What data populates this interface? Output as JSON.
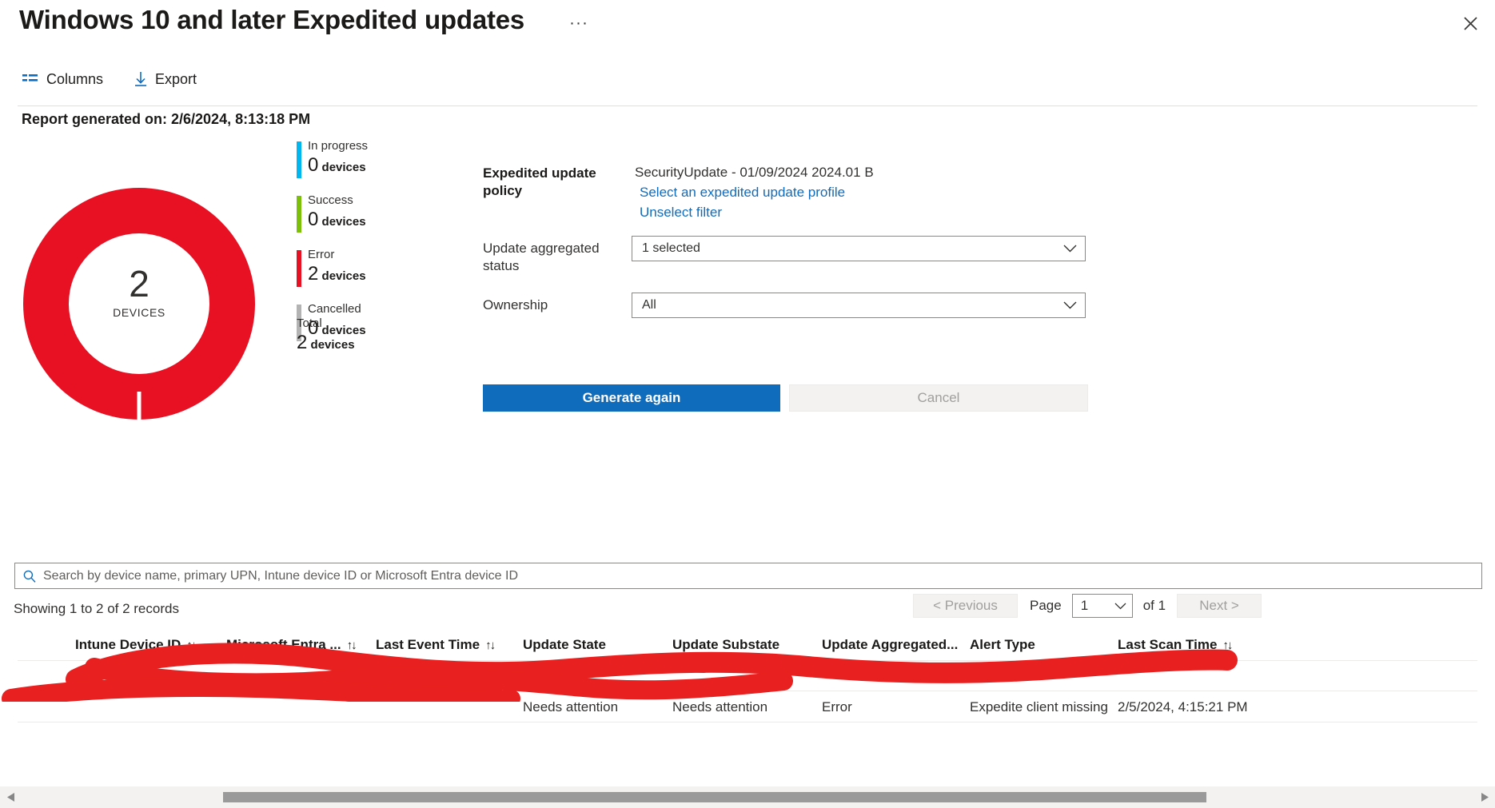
{
  "header": {
    "title": "Windows 10 and later Expedited updates",
    "more_label": "···",
    "close_label": "close-icon"
  },
  "commandbar": {
    "columns_label": "Columns",
    "export_label": "Export"
  },
  "report": {
    "generated_on": "Report generated on: 2/6/2024, 8:13:18 PM"
  },
  "donut": {
    "center_value": "2",
    "center_label": "DEVICES",
    "segments": [
      {
        "name": "Error",
        "value": 2,
        "color": "#e81123"
      }
    ]
  },
  "legend": {
    "items": [
      {
        "label": "In progress",
        "value": "0",
        "unit": "devices",
        "color": "#00b7f0"
      },
      {
        "label": "Success",
        "value": "0",
        "unit": "devices",
        "color": "#7cc00a"
      },
      {
        "label": "Error",
        "value": "2",
        "unit": "devices",
        "color": "#e81123"
      },
      {
        "label": "Cancelled",
        "value": "0",
        "unit": "devices",
        "color": "#b3b3b3"
      }
    ],
    "total": {
      "label": "Total",
      "value": "2",
      "unit": "devices"
    }
  },
  "filters": {
    "policy_label": "Expedited update policy",
    "policy_value": "SecurityUpdate - 01/09/2024 2024.01 B",
    "select_profile_link": "Select an expedited update profile",
    "unselect_filter_link": "Unselect filter",
    "aggregated_status_label": "Update aggregated status",
    "aggregated_status_value": "1 selected",
    "ownership_label": "Ownership",
    "ownership_value": "All"
  },
  "actions": {
    "generate_again": "Generate again",
    "cancel": "Cancel"
  },
  "search": {
    "placeholder": "Search by device name, primary UPN, Intune device ID or Microsoft Entra device ID",
    "value": ""
  },
  "pagination": {
    "records_text": "Showing 1 to 2 of 2 records",
    "previous": "< Previous",
    "page_label": "Page",
    "page_value": "1",
    "of_text": "of 1",
    "next": "Next >"
  },
  "table": {
    "columns": [
      {
        "label": "Intune Device ID",
        "sortable": true
      },
      {
        "label": "Microsoft Entra ...",
        "sortable": true
      },
      {
        "label": "Last Event Time",
        "sortable": true
      },
      {
        "label": "Update State",
        "sortable": false
      },
      {
        "label": "Update Substate",
        "sortable": false
      },
      {
        "label": "Update Aggregated...",
        "sortable": false
      },
      {
        "label": "Alert Type",
        "sortable": false
      },
      {
        "label": "Last Scan Time",
        "sortable": true
      }
    ],
    "sort_icon": "↑↓",
    "rows": [
      {
        "intune_device_id": "",
        "entra_device_id": "",
        "last_event_time": "",
        "update_state": "",
        "update_substate": "",
        "update_aggregated": "",
        "alert_type": "",
        "last_scan_time": ""
      },
      {
        "intune_device_id": "",
        "entra_device_id": "",
        "last_event_time": "",
        "update_state": "Needs attention",
        "update_substate": "Needs attention",
        "update_aggregated": "Error",
        "alert_type": "Expedite client missing",
        "last_scan_time": "2/5/2024, 4:15:21 PM"
      }
    ]
  },
  "scrollbar": {
    "left_arrow": "◀",
    "right_arrow": "▶"
  },
  "colors": {
    "accent": "#0f6cbd",
    "error": "#e81123",
    "success": "#7cc00a",
    "in_progress": "#00b7f0",
    "cancelled": "#b3b3b3"
  }
}
